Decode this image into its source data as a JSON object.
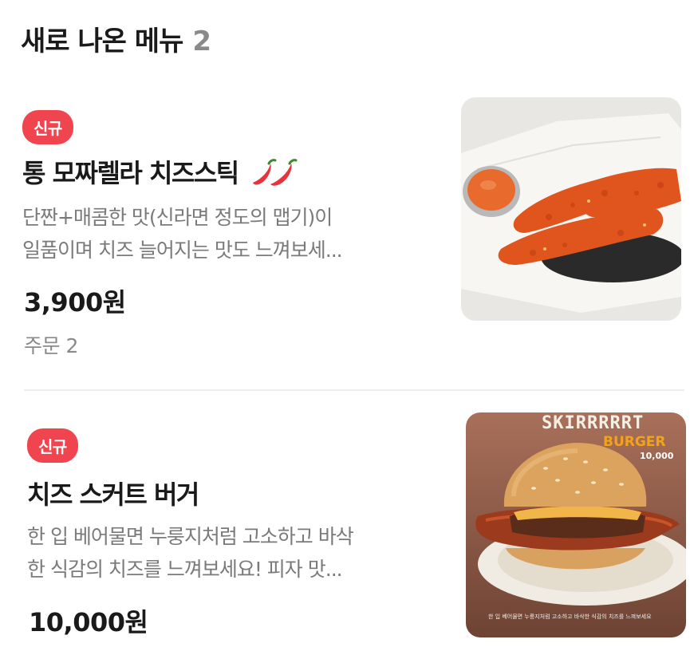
{
  "header": {
    "title": "새로 나온 메뉴",
    "count": "2"
  },
  "items": [
    {
      "badge": "신규",
      "name": "통 모짜렐라 치즈스틱",
      "spicy_icon": "chili-pepper-icon",
      "description": "단짠+매콤한 맛(신라면 정도의 맵기)이\n일품이며 치즈 늘어지는 맛도 느껴보세...",
      "price": "3,900원",
      "orders": "주문 2",
      "image_alt": "cheese-stick-photo"
    },
    {
      "badge": "신규",
      "name": "치즈 스커트 버거",
      "description": "한 입 베어물면 누룽지처럼 고소하고 바삭\n한 식감의 치즈를 느껴보세요! 피자 맛...",
      "price": "10,000원",
      "image_alt": "burger-photo",
      "image_text": {
        "headline": "SKIRRRRRT",
        "sub": "BURGER",
        "price": "10,000",
        "caption": "한 입 베어물면 누룽지처럼 고소하고 바삭한 식감의 치즈를 느껴보세요"
      }
    }
  ],
  "colors": {
    "badge": "#f0454f",
    "muted_text": "#7a7a7a",
    "accent_orange": "#f2a31b"
  }
}
